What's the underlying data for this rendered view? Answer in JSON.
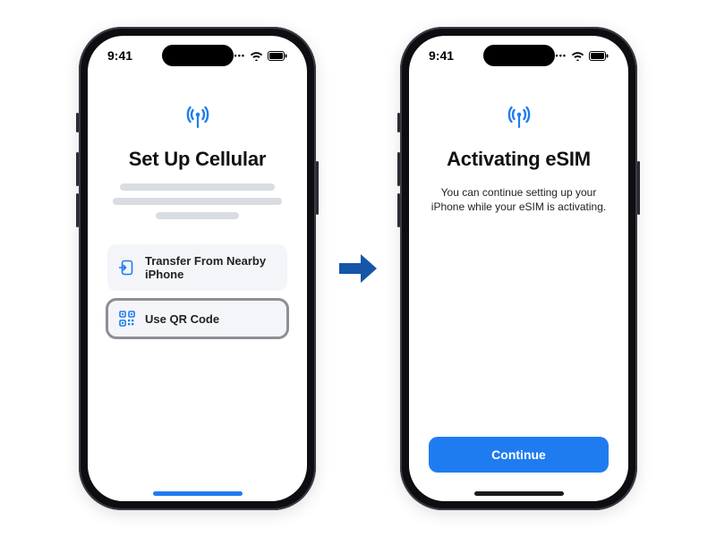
{
  "status": {
    "time": "9:41"
  },
  "accent": "#1f7cf0",
  "left": {
    "title": "Set Up Cellular",
    "options": [
      {
        "icon": "transfer-icon",
        "label": "Transfer From Nearby iPhone"
      },
      {
        "icon": "qr-icon",
        "label": "Use QR Code"
      }
    ]
  },
  "right": {
    "title": "Activating eSIM",
    "body": "You can continue setting up your iPhone while your eSIM is activating.",
    "continue_label": "Continue"
  }
}
